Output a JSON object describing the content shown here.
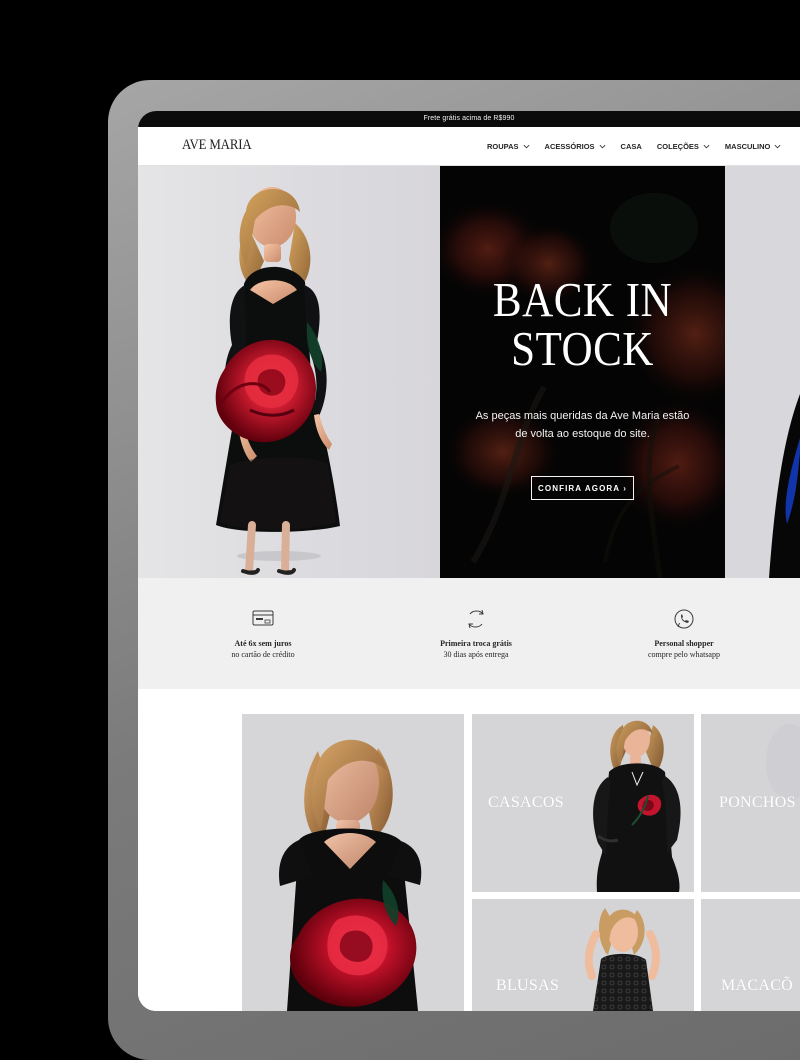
{
  "announcement": {
    "text": "Frete grátis acima de R$990"
  },
  "header": {
    "logo": "AVE MARIA",
    "nav": [
      {
        "label": "ROUPAS"
      },
      {
        "label": "ACESSÓRIOS"
      },
      {
        "label": "CASA"
      },
      {
        "label": "COLEÇÕES"
      },
      {
        "label": "MASCULINO"
      }
    ]
  },
  "hero": {
    "title_line1": "BACK IN",
    "title_line2": "STOCK",
    "description_line1": "As peças mais queridas da Ave Maria estão",
    "description_line2": "de volta ao estoque do site.",
    "cta": "CONFIRA AGORA ›"
  },
  "benefits": [
    {
      "title": "Até 6x sem juros",
      "subtitle": "no cartão de crédito",
      "icon": "credit-card-icon"
    },
    {
      "title": "Primeira troca grátis",
      "subtitle": "30 dias após entrega",
      "icon": "exchange-icon"
    },
    {
      "title": "Personal shopper",
      "subtitle": "compre pelo whatsapp",
      "icon": "whatsapp-icon"
    }
  ],
  "categories": {
    "items": [
      {
        "label": "CASACOS"
      },
      {
        "label": "PONCHOS"
      },
      {
        "label": "BLUSAS"
      },
      {
        "label": "MACACÕ"
      }
    ]
  },
  "colors": {
    "black": "#070606",
    "rose_red": "#b3122a",
    "panel_gray": "#f0f0f0"
  }
}
